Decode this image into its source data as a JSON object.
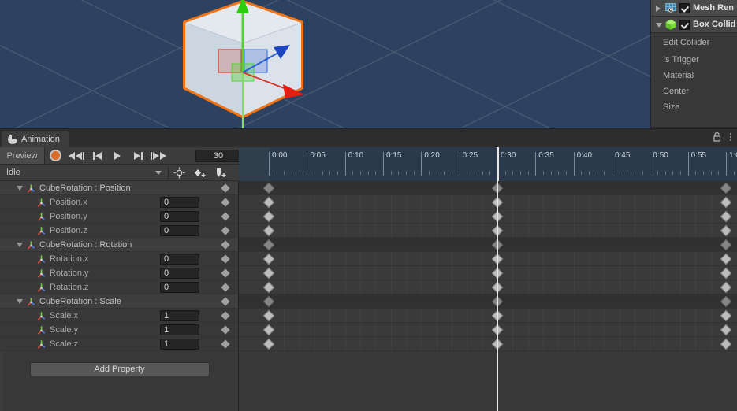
{
  "viewport": {
    "name": "scene-view",
    "background_color": "#2c4260",
    "grid_color": "#5e7186",
    "selection_outline_color": "#f07315",
    "cube_face_color": "#dde3ea",
    "gizmo": {
      "x_axis_color": "#d63a2f",
      "y_axis_color": "#4fd82c",
      "z_axis_color": "#2b5fd6"
    }
  },
  "inspector": {
    "components": [
      {
        "label": "Mesh Ren",
        "icon": "mesh-renderer-icon",
        "enabled": true,
        "expanded": false
      },
      {
        "label": "Box Collid",
        "icon": "box-collider-icon",
        "enabled": true,
        "expanded": true
      }
    ],
    "box_collider_fields": [
      {
        "label": "Edit Collider"
      },
      {
        "label": "Is Trigger"
      },
      {
        "label": "Material"
      },
      {
        "label": "Center"
      },
      {
        "label": "Size"
      }
    ]
  },
  "animation_window": {
    "tab": {
      "label": "Animation",
      "icon": "clock-icon"
    },
    "tab_tools": {
      "lock": "lock-icon",
      "menu": "kebab-menu-icon"
    },
    "toolbar": {
      "preview_label": "Preview",
      "record_label": "record-button",
      "first_frame_label": "first-frame-button",
      "prev_frame_label": "previous-frame-button",
      "play_label": "play-button",
      "next_frame_label": "next-frame-button",
      "last_frame_label": "last-frame-button",
      "frame_value": "30"
    },
    "clip_bar": {
      "clip_name": "Idle",
      "filter_label": "filter-by-selection-button",
      "add_keyframe_label": "add-keyframe-button",
      "add_event_label": "add-event-button"
    },
    "add_property_label": "Add Property",
    "properties": [
      {
        "label": "CubeRotation : Position",
        "type": "group",
        "value": null,
        "expanded": true
      },
      {
        "label": "Position.x",
        "type": "child",
        "value": "0"
      },
      {
        "label": "Position.y",
        "type": "child",
        "value": "0"
      },
      {
        "label": "Position.z",
        "type": "child",
        "value": "0"
      },
      {
        "label": "CubeRotation : Rotation",
        "type": "group",
        "value": null,
        "expanded": true
      },
      {
        "label": "Rotation.x",
        "type": "child",
        "value": "0"
      },
      {
        "label": "Rotation.y",
        "type": "child",
        "value": "0"
      },
      {
        "label": "Rotation.z",
        "type": "child",
        "value": "0"
      },
      {
        "label": "CubeRotation : Scale",
        "type": "group",
        "value": null,
        "expanded": true
      },
      {
        "label": "Scale.x",
        "type": "child",
        "value": "1"
      },
      {
        "label": "Scale.y",
        "type": "child",
        "value": "1"
      },
      {
        "label": "Scale.z",
        "type": "child",
        "value": "1"
      }
    ],
    "timeline": {
      "ticks": [
        "0:00",
        "0:05",
        "0:10",
        "0:15",
        "0:20",
        "0:25",
        "0:30",
        "0:35",
        "0:40",
        "0:45",
        "0:50",
        "0:55",
        "1:0"
      ],
      "playhead_time": "0:30",
      "keyframe_times": [
        "0:00",
        "0:30",
        "1:00"
      ]
    }
  }
}
